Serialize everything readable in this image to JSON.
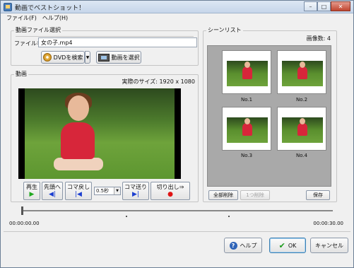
{
  "window": {
    "title": "動画でベストショット！",
    "buttons": {
      "minimize": "–",
      "maximize": "□",
      "close": "✕"
    }
  },
  "menu": {
    "items": [
      "ファイル(F)",
      "ヘルプ(H)"
    ]
  },
  "file_select": {
    "group_label": "動画ファイル選択",
    "filename_label": "ファイル名",
    "filename_value": "女の子.mp4",
    "dvd_button": "DVDを検索",
    "select_button": "動画を選択"
  },
  "video": {
    "group_label": "動画",
    "actual_size": "実際のサイズ: 1920 x 1080"
  },
  "controls": {
    "play": {
      "label": "再生",
      "glyph": "▶"
    },
    "to_start": {
      "label": "先頭へ",
      "glyph": "◀|"
    },
    "frame_back": {
      "label": "コマ戻し",
      "glyph": "|◀"
    },
    "step": "0.5秒",
    "frame_forward": {
      "label": "コマ送り",
      "glyph": "▶|"
    },
    "cut": {
      "label": "切り出し⇒",
      "glyph": "●"
    }
  },
  "scenes": {
    "group_label": "シーンリスト",
    "count": "画像数: 4",
    "thumbnails": [
      "No.1",
      "No.2",
      "No.3",
      "No.4"
    ],
    "delete_all": "全部削除",
    "delete_one": "1つ削除",
    "save": "保存"
  },
  "timeline": {
    "start": "00:00:00.00",
    "end": "00:00:30.00"
  },
  "footer": {
    "help": "ヘルプ",
    "ok": "OK",
    "cancel": "キャンセル"
  },
  "icons": {
    "help": "?",
    "check": "✔"
  }
}
